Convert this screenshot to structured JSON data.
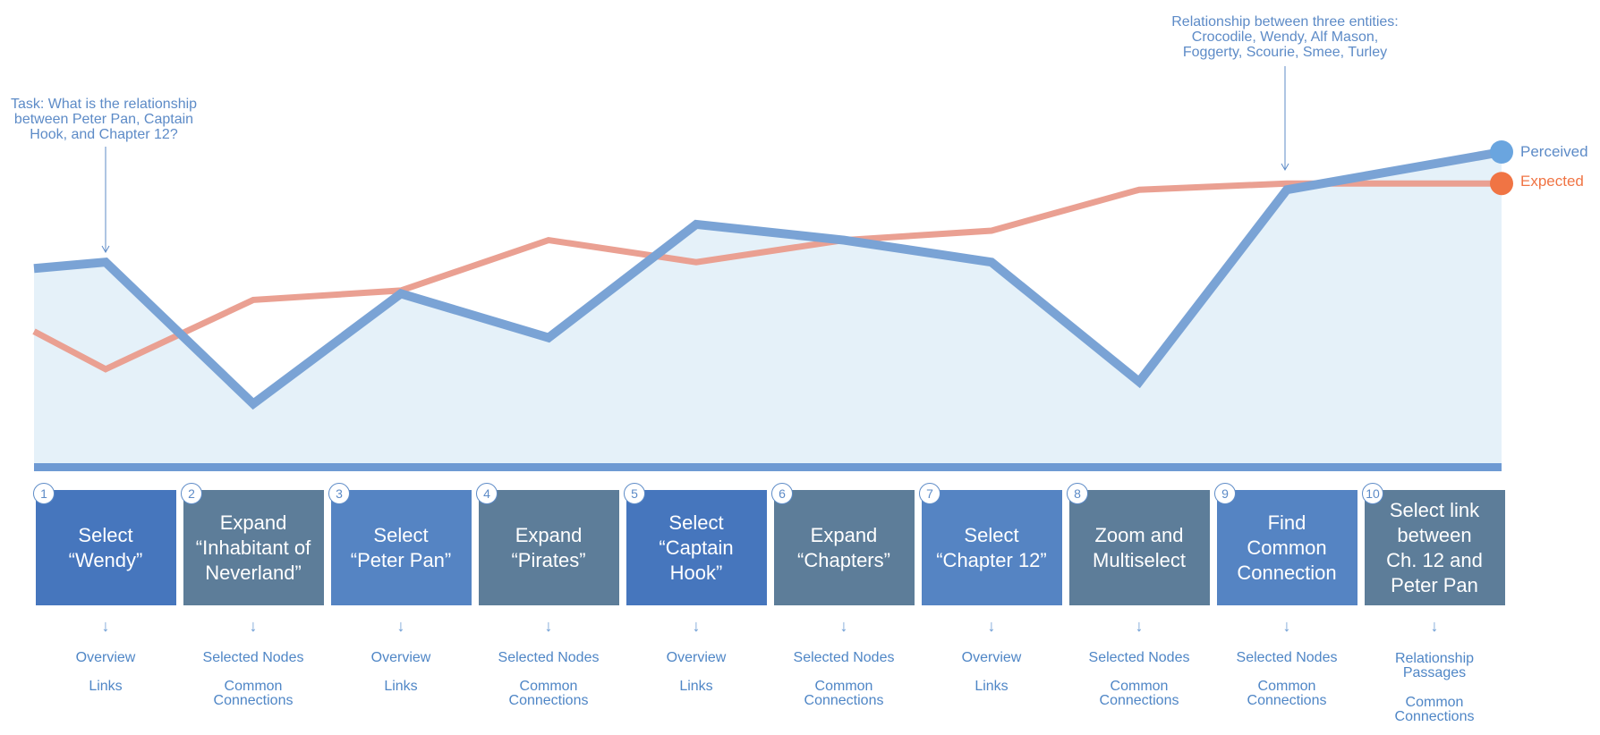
{
  "chart_data": {
    "type": "line",
    "x": [
      0,
      1,
      2,
      3,
      4,
      5,
      6,
      7,
      8,
      9,
      10
    ],
    "ylim": [
      0,
      100
    ],
    "series": [
      {
        "name": "Perceived",
        "color": "#7aa3d5",
        "fill": "#e5f1f9",
        "values": [
          63,
          65,
          20,
          55,
          41,
          77,
          72,
          65,
          27,
          88,
          100
        ]
      },
      {
        "name": "Expected",
        "color": "#eaa092",
        "marker_color": "#f07444",
        "values": [
          43,
          31,
          53,
          56,
          72,
          65,
          72,
          75,
          88,
          90,
          90
        ]
      }
    ],
    "legend_position": "right"
  },
  "annotations": {
    "task": "Task: What is the relationship\nbetween Peter Pan, Captain\nHook, and Chapter 12?",
    "relationship": "Relationship between three entities:\nCrocodile, Wendy, Alf Mason,\nFoggerty, Scourie, Smee, Turley"
  },
  "steps": [
    {
      "num": "1",
      "text": "Select\n“Wendy”",
      "color": "#4676bd",
      "labels": [
        "Overview",
        "Links"
      ]
    },
    {
      "num": "2",
      "text": "Expand\n“Inhabitant of\nNeverland”",
      "color": "#5d7d99",
      "labels": [
        "Selected Nodes",
        "Common\nConnections"
      ]
    },
    {
      "num": "3",
      "text": "Select\n“Peter Pan”",
      "color": "#5584c3",
      "labels": [
        "Overview",
        "Links"
      ]
    },
    {
      "num": "4",
      "text": "Expand\n“Pirates”",
      "color": "#5d7d99",
      "labels": [
        "Selected Nodes",
        "Common\nConnections"
      ]
    },
    {
      "num": "5",
      "text": "Select\n“Captain\nHook”",
      "color": "#4676bd",
      "labels": [
        "Overview",
        "Links"
      ]
    },
    {
      "num": "6",
      "text": "Expand\n“Chapters”",
      "color": "#5d7d99",
      "labels": [
        "Selected Nodes",
        "Common\nConnections"
      ]
    },
    {
      "num": "7",
      "text": "Select\n“Chapter 12”",
      "color": "#5584c3",
      "labels": [
        "Overview",
        "Links"
      ]
    },
    {
      "num": "8",
      "text": "Zoom and\nMultiselect",
      "color": "#5d7d99",
      "labels": [
        "Selected Nodes",
        "Common\nConnections"
      ]
    },
    {
      "num": "9",
      "text": "Find\nCommon\nConnection",
      "color": "#5584c3",
      "labels": [
        "Selected Nodes",
        "Common\nConnections"
      ]
    },
    {
      "num": "10",
      "text": "Select link\nbetween\nCh. 12 and\nPeter Pan",
      "color": "#5d7d99",
      "labels": [
        "Relationship\nPassages",
        "Common\nConnections"
      ]
    }
  ],
  "colors": {
    "baseline": "#6e9ad3",
    "annotation": "#5d8bc7"
  }
}
